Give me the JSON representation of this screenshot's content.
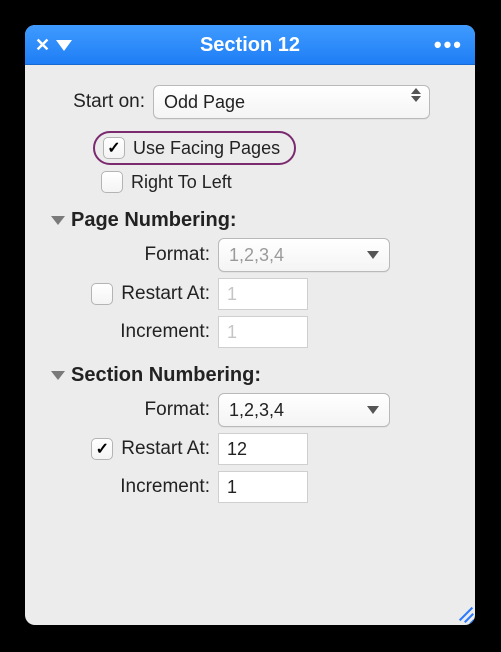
{
  "titlebar": {
    "title": "Section 12"
  },
  "start_on": {
    "label": "Start on:",
    "value": "Odd Page"
  },
  "facing_pages": {
    "label": "Use Facing Pages",
    "checked": true
  },
  "right_to_left": {
    "label": "Right To Left",
    "checked": false
  },
  "page_numbering": {
    "header": "Page Numbering:",
    "format_label": "Format:",
    "format_value": "1,2,3,4",
    "restart_label": "Restart At:",
    "restart_checked": false,
    "restart_value": "1",
    "increment_label": "Increment:",
    "increment_value": "1"
  },
  "section_numbering": {
    "header": "Section Numbering:",
    "format_label": "Format:",
    "format_value": "1,2,3,4",
    "restart_label": "Restart At:",
    "restart_checked": true,
    "restart_value": "12",
    "increment_label": "Increment:",
    "increment_value": "1"
  }
}
